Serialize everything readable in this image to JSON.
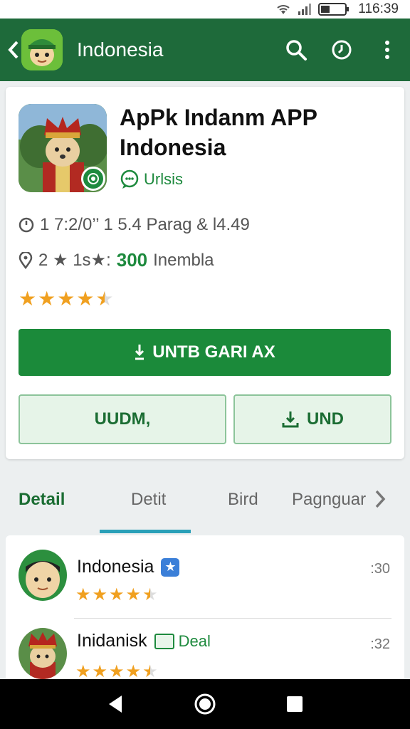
{
  "status_bar": {
    "time": "116:39"
  },
  "app_bar": {
    "title": "Indonesia"
  },
  "app": {
    "title": "ApPk Indanm APP Indonesia",
    "developer_label": "Urlsis",
    "meta_line1": "1 7:2/0’’ 1 5.4 Parag & l4.49",
    "meta_line2_prefix": "2 ★ 1s★:",
    "meta_line2_highlight": "300",
    "meta_line2_suffix": "Inembla",
    "rating": 4.5,
    "primary_button": "UNTB GARI AX",
    "secondary_left": "UUDM,",
    "secondary_right": "UND"
  },
  "tabs": [
    {
      "label": "Detail",
      "active": true
    },
    {
      "label": "Detit",
      "active": false
    },
    {
      "label": "Bird",
      "active": false
    },
    {
      "label": "Pagnguar",
      "active": false
    }
  ],
  "list": [
    {
      "name": "Indonesia",
      "badge_icon": "star-badge-icon",
      "rating": 4.5,
      "count": ":30"
    },
    {
      "name": "Inidanisk",
      "tag": "Deal",
      "rating": 4.5,
      "count": ":32"
    }
  ],
  "colors": {
    "app_bar": "#1e6a3a",
    "primary": "#1b8a3a",
    "accent_indicator": "#2aa0b8",
    "star": "#f0a020"
  }
}
